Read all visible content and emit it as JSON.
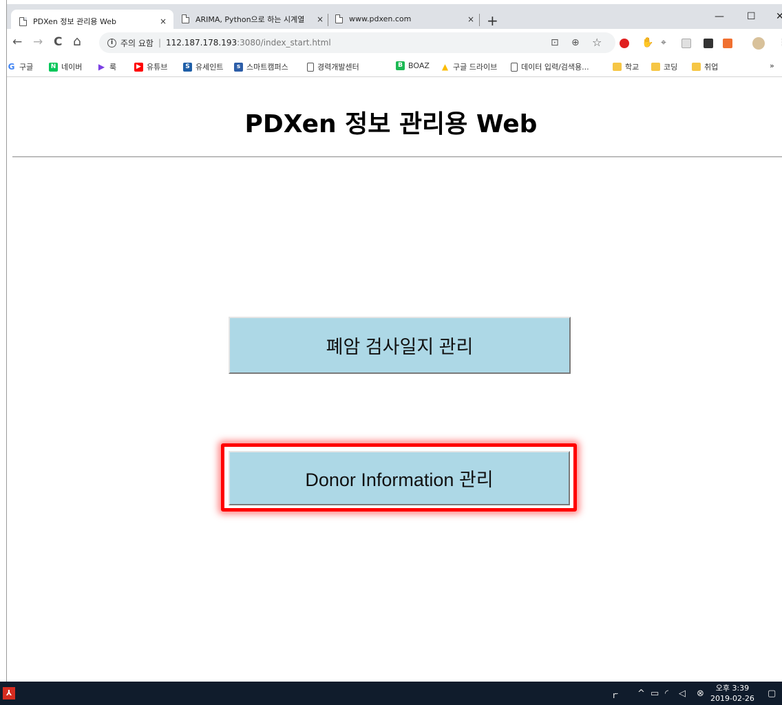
{
  "browser": {
    "tabs": [
      {
        "title": "PDXen 정보 관리용 Web",
        "close": "×"
      },
      {
        "title": "ARIMA, Python으로 하는 시계열",
        "close": "×"
      },
      {
        "title": "www.pdxen.com",
        "close": "×"
      }
    ],
    "new_tab": "+",
    "window": {
      "minimize": "—",
      "maximize": "☐",
      "close": "✕"
    },
    "nav": {
      "back": "←",
      "forward": "→",
      "reload": "C",
      "home": "⌂"
    },
    "omnibox": {
      "security": "주의 요함",
      "separator": "|",
      "host": "112.187.178.193",
      "path": ":3080/index_start.html"
    },
    "bookmarks": [
      {
        "label": "구글",
        "icon": "google-icon",
        "color": "#4285f4",
        "glyph": "G"
      },
      {
        "label": "네이버",
        "icon": "naver-icon",
        "color": "#03c75a",
        "glyph": "N"
      },
      {
        "label": "룩",
        "icon": "play-icon",
        "color": "#7b3fe4",
        "glyph": "▶"
      },
      {
        "label": "유튜브",
        "icon": "youtube-icon",
        "color": "#ff0000",
        "glyph": "▶"
      },
      {
        "label": "유세인트",
        "icon": "sap-icon",
        "color": "#1f5fa8",
        "glyph": "S"
      },
      {
        "label": "스마트캠퍼스",
        "icon": "campus-icon",
        "color": "#2d5ea8",
        "glyph": "s"
      },
      {
        "label": "경력개발센터",
        "icon": "page-icon",
        "color": "#ffffff",
        "glyph": ""
      },
      {
        "label": "BOAZ",
        "icon": "boaz-icon",
        "color": "#1db954",
        "glyph": "B"
      },
      {
        "label": "구글 드라이브",
        "icon": "drive-icon",
        "color": "#fbbc04",
        "glyph": "▲"
      },
      {
        "label": "데이터 입력/검색용...",
        "icon": "page-icon",
        "color": "#ffffff",
        "glyph": ""
      },
      {
        "label": "학교",
        "icon": "folder-icon",
        "color": "#f6c645",
        "glyph": ""
      },
      {
        "label": "코딩",
        "icon": "folder-icon",
        "color": "#f6c645",
        "glyph": ""
      },
      {
        "label": "취업",
        "icon": "folder-icon",
        "color": "#f6c645",
        "glyph": ""
      }
    ],
    "bookmarks_overflow": "»"
  },
  "page": {
    "title": "PDXen 정보 관리용 Web",
    "buttons": {
      "lung_cancer": "폐암 검사일지 관리",
      "donor": "Donor Information 관리"
    }
  },
  "taskbar": {
    "time": "오후 3:39",
    "date": "2019-02-26"
  },
  "colors": {
    "button_bg": "#add8e6",
    "highlight": "#ff0000",
    "taskbar": "#101c2c"
  }
}
